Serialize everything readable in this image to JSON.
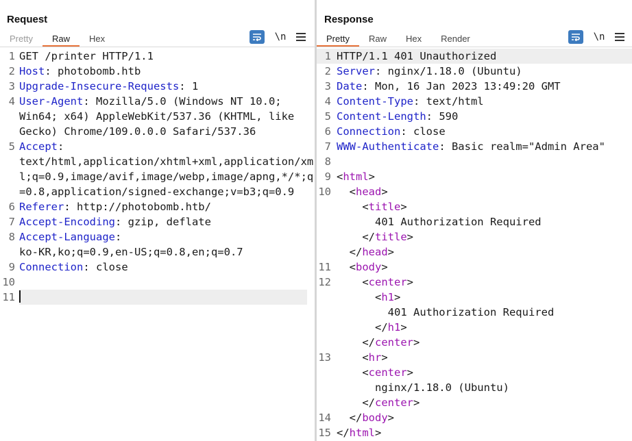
{
  "request": {
    "title": "Request",
    "tabs": [
      "Pretty",
      "Raw",
      "Hex"
    ],
    "active_tab": "Raw",
    "newline_label": "\\n",
    "lines": [
      {
        "n": "1",
        "parts": [
          {
            "t": "GET /printer HTTP/1.1"
          }
        ]
      },
      {
        "n": "2",
        "parts": [
          {
            "k": "Host"
          },
          {
            "t": ": photobomb.htb"
          }
        ]
      },
      {
        "n": "3",
        "parts": [
          {
            "k": "Upgrade-Insecure-Requests"
          },
          {
            "t": ": 1"
          }
        ]
      },
      {
        "n": "4",
        "parts": [
          {
            "k": "User-Agent"
          },
          {
            "t": ": Mozilla/5.0 (Windows NT 10.0;"
          }
        ]
      },
      {
        "n": "",
        "parts": [
          {
            "t": "Win64; x64) AppleWebKit/537.36 (KHTML, like"
          }
        ]
      },
      {
        "n": "",
        "parts": [
          {
            "t": "Gecko) Chrome/109.0.0.0 Safari/537.36"
          }
        ]
      },
      {
        "n": "5",
        "parts": [
          {
            "k": "Accept"
          },
          {
            "t": ":"
          }
        ]
      },
      {
        "n": "",
        "parts": [
          {
            "t": "text/html,application/xhtml+xml,application/xm"
          }
        ]
      },
      {
        "n": "",
        "parts": [
          {
            "t": "l;q=0.9,image/avif,image/webp,image/apng,*/*;q"
          }
        ]
      },
      {
        "n": "",
        "parts": [
          {
            "t": "=0.8,application/signed-exchange;v=b3;q=0.9"
          }
        ]
      },
      {
        "n": "6",
        "parts": [
          {
            "k": "Referer"
          },
          {
            "t": ": http://photobomb.htb/"
          }
        ]
      },
      {
        "n": "7",
        "parts": [
          {
            "k": "Accept-Encoding"
          },
          {
            "t": ": gzip, deflate"
          }
        ]
      },
      {
        "n": "8",
        "parts": [
          {
            "k": "Accept-Language"
          },
          {
            "t": ":"
          }
        ]
      },
      {
        "n": "",
        "parts": [
          {
            "t": "ko-KR,ko;q=0.9,en-US;q=0.8,en;q=0.7"
          }
        ]
      },
      {
        "n": "9",
        "parts": [
          {
            "k": "Connection"
          },
          {
            "t": ": close"
          }
        ]
      },
      {
        "n": "10",
        "parts": []
      },
      {
        "n": "11",
        "parts": [],
        "cursor": true
      }
    ]
  },
  "response": {
    "title": "Response",
    "tabs": [
      "Pretty",
      "Raw",
      "Hex",
      "Render"
    ],
    "active_tab": "Pretty",
    "newline_label": "\\n",
    "lines": [
      {
        "n": "1",
        "hl": true,
        "parts": [
          {
            "t": "HTTP/1.1 401 Unauthorized"
          }
        ]
      },
      {
        "n": "2",
        "parts": [
          {
            "k": "Server"
          },
          {
            "t": ": nginx/1.18.0 (Ubuntu)"
          }
        ]
      },
      {
        "n": "3",
        "parts": [
          {
            "k": "Date"
          },
          {
            "t": ": Mon, 16 Jan 2023 13:49:20 GMT"
          }
        ]
      },
      {
        "n": "4",
        "parts": [
          {
            "k": "Content-Type"
          },
          {
            "t": ": text/html"
          }
        ]
      },
      {
        "n": "5",
        "parts": [
          {
            "k": "Content-Length"
          },
          {
            "t": ": 590"
          }
        ]
      },
      {
        "n": "6",
        "parts": [
          {
            "k": "Connection"
          },
          {
            "t": ": close"
          }
        ]
      },
      {
        "n": "7",
        "parts": [
          {
            "k": "WWW-Authenticate"
          },
          {
            "t": ": Basic realm=\"Admin Area\""
          }
        ]
      },
      {
        "n": "8",
        "parts": []
      },
      {
        "n": "9",
        "parts": [
          {
            "t": "<"
          },
          {
            "g": "html"
          },
          {
            "t": ">"
          }
        ]
      },
      {
        "n": "10",
        "parts": [
          {
            "t": "  <"
          },
          {
            "g": "head"
          },
          {
            "t": ">"
          }
        ]
      },
      {
        "n": "",
        "parts": [
          {
            "t": "    <"
          },
          {
            "g": "title"
          },
          {
            "t": ">"
          }
        ]
      },
      {
        "n": "",
        "parts": [
          {
            "t": "      401 Authorization Required"
          }
        ]
      },
      {
        "n": "",
        "parts": [
          {
            "t": "    </"
          },
          {
            "g": "title"
          },
          {
            "t": ">"
          }
        ]
      },
      {
        "n": "",
        "parts": [
          {
            "t": "  </"
          },
          {
            "g": "head"
          },
          {
            "t": ">"
          }
        ]
      },
      {
        "n": "11",
        "parts": [
          {
            "t": "  <"
          },
          {
            "g": "body"
          },
          {
            "t": ">"
          }
        ]
      },
      {
        "n": "12",
        "parts": [
          {
            "t": "    <"
          },
          {
            "g": "center"
          },
          {
            "t": ">"
          }
        ]
      },
      {
        "n": "",
        "parts": [
          {
            "t": "      <"
          },
          {
            "g": "h1"
          },
          {
            "t": ">"
          }
        ]
      },
      {
        "n": "",
        "parts": [
          {
            "t": "        401 Authorization Required"
          }
        ]
      },
      {
        "n": "",
        "parts": [
          {
            "t": "      </"
          },
          {
            "g": "h1"
          },
          {
            "t": ">"
          }
        ]
      },
      {
        "n": "",
        "parts": [
          {
            "t": "    </"
          },
          {
            "g": "center"
          },
          {
            "t": ">"
          }
        ]
      },
      {
        "n": "13",
        "parts": [
          {
            "t": "    <"
          },
          {
            "g": "hr"
          },
          {
            "t": ">"
          }
        ]
      },
      {
        "n": "",
        "parts": [
          {
            "t": "    <"
          },
          {
            "g": "center"
          },
          {
            "t": ">"
          }
        ]
      },
      {
        "n": "",
        "parts": [
          {
            "t": "      nginx/1.18.0 (Ubuntu)"
          }
        ]
      },
      {
        "n": "",
        "parts": [
          {
            "t": "    </"
          },
          {
            "g": "center"
          },
          {
            "t": ">"
          }
        ]
      },
      {
        "n": "14",
        "parts": [
          {
            "t": "  </"
          },
          {
            "g": "body"
          },
          {
            "t": ">"
          }
        ]
      },
      {
        "n": "15",
        "parts": [
          {
            "t": "</"
          },
          {
            "g": "html"
          },
          {
            "t": ">"
          }
        ]
      }
    ]
  },
  "layout_switch": {
    "icons": [
      "side-by-side-layout-icon",
      "top-bottom-layout-icon",
      "tabs-layout-icon"
    ],
    "active": "side-by-side-layout-icon"
  },
  "colors": {
    "header_key": "#1f24c9",
    "html_tag": "#9c16b0",
    "accent_tab_underline": "#e8743b",
    "button_blue": "#3d7bbf"
  }
}
